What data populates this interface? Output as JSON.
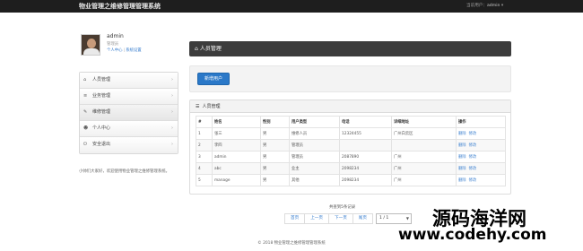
{
  "header": {
    "brand": "物业管理之维修管理管理系统",
    "user_prefix": "当前用户：",
    "user_name": "admin",
    "user_caret": "▾"
  },
  "profile": {
    "name": "admin",
    "role": "管理员",
    "link_center": "个人中心",
    "link_sep": "|",
    "link_settings": "系统设置"
  },
  "sidebar": {
    "items": [
      {
        "label": "人员管理",
        "icon": "home-icon",
        "glyph": "⌂"
      },
      {
        "label": "业务管理",
        "icon": "list-icon",
        "glyph": "≡"
      },
      {
        "label": "维修管理",
        "icon": "wrench-icon",
        "glyph": "✎"
      },
      {
        "label": "个人中心",
        "icon": "user-icon",
        "glyph": "☻"
      },
      {
        "label": "安全退出",
        "icon": "power-icon",
        "glyph": "⏻"
      }
    ],
    "note": "小帅们大家好，欢迎使用物业管理之维修管理系统。"
  },
  "main": {
    "title": "人员管理",
    "title_glyph": "⌂",
    "add_button": "新增用户",
    "table_title": "人员管理",
    "table_glyph": "☰",
    "columns": [
      "#",
      "姓名",
      "性别",
      "用户类型",
      "电话",
      "详细地址",
      "操作"
    ],
    "rows": [
      [
        "1",
        "张三",
        "男",
        "维修人员",
        "12324455",
        "广州白云区",
        ""
      ],
      [
        "2",
        "李四",
        "男",
        "管理员",
        "",
        "",
        ""
      ],
      [
        "3",
        "admin",
        "男",
        "管理员",
        "2087890",
        "广州",
        ""
      ],
      [
        "4",
        "abc",
        "男",
        "业主",
        "2098234",
        "广州",
        ""
      ],
      [
        "5",
        "manage",
        "男",
        "其他",
        "2098234",
        "广州",
        ""
      ]
    ],
    "actions": {
      "delete": "删除",
      "edit": "修改"
    }
  },
  "pager": {
    "info": "共查到5条记录",
    "first": "首页",
    "prev": "上一页",
    "next": "下一页",
    "last": "尾页",
    "page_select": "1 / 1"
  },
  "footer": {
    "copyright": "© 2018 物业管理之维修管理管理系统"
  },
  "watermark": {
    "cn": "源码海洋网",
    "url": "www.codehy.com"
  }
}
